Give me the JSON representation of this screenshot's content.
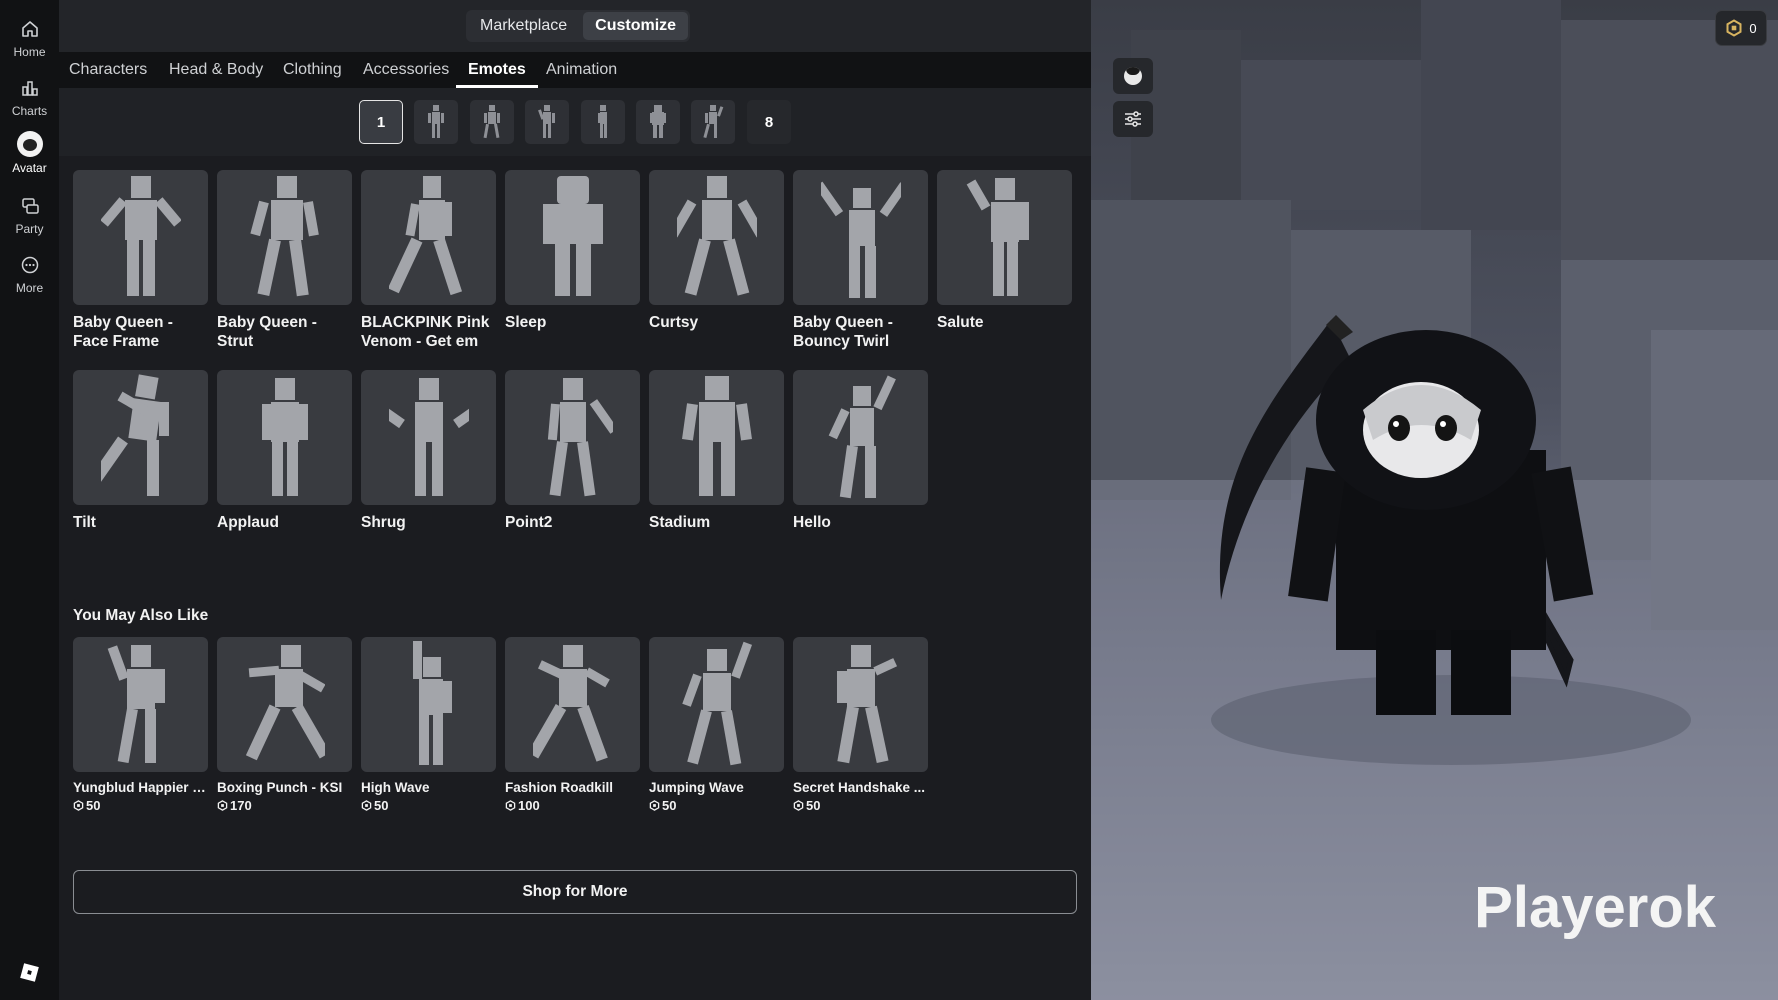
{
  "nav": [
    {
      "label": "Home",
      "icon": "home-icon"
    },
    {
      "label": "Charts",
      "icon": "charts-icon"
    },
    {
      "label": "Avatar",
      "icon": "avatar-icon"
    },
    {
      "label": "Party",
      "icon": "party-icon"
    },
    {
      "label": "More",
      "icon": "more-icon"
    }
  ],
  "header": {
    "marketplace": "Marketplace",
    "customize": "Customize"
  },
  "tabs": [
    "Characters",
    "Head & Body",
    "Clothing",
    "Accessories",
    "Emotes",
    "Animation"
  ],
  "active_tab": "Emotes",
  "slots": {
    "first": "1",
    "last": "8"
  },
  "emotes": [
    "Baby Queen - Face Frame",
    "Baby Queen - Strut",
    "BLACKPINK Pink Venom - Get em",
    "Sleep",
    "Curtsy",
    "Baby Queen - Bouncy Twirl",
    "Salute",
    "Tilt",
    "Applaud",
    "Shrug",
    "Point2",
    "Stadium",
    "Hello"
  ],
  "recommend_title": "You May Also Like",
  "recommendations": [
    {
      "name": "Yungblud Happier J...",
      "price": "50"
    },
    {
      "name": "Boxing Punch - KSI",
      "price": "170"
    },
    {
      "name": "High Wave",
      "price": "50"
    },
    {
      "name": "Fashion Roadkill",
      "price": "100"
    },
    {
      "name": "Jumping Wave",
      "price": "50"
    },
    {
      "name": "Secret Handshake ...",
      "price": "50"
    }
  ],
  "shop_button": "Shop for More",
  "robux_balance": "0",
  "username": "Playerok"
}
